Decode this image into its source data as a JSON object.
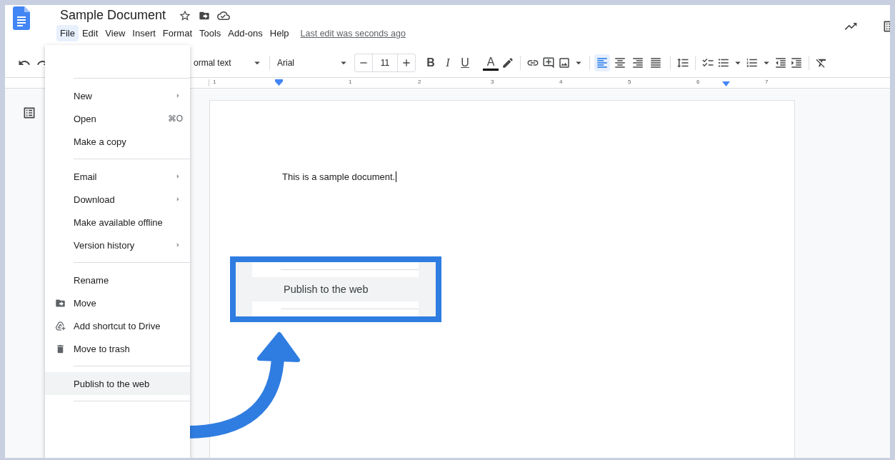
{
  "document": {
    "title": "Sample Document",
    "last_edit": "Last edit was seconds ago"
  },
  "menu_bar": [
    {
      "label": "File",
      "selected": true
    },
    {
      "label": "Edit",
      "selected": false
    },
    {
      "label": "View",
      "selected": false
    },
    {
      "label": "Insert",
      "selected": false
    },
    {
      "label": "Format",
      "selected": false
    },
    {
      "label": "Tools",
      "selected": false
    },
    {
      "label": "Add-ons",
      "selected": false
    },
    {
      "label": "Help",
      "selected": false
    }
  ],
  "toolbar": {
    "style_select": "ormal text",
    "font": "Arial",
    "font_size": "11",
    "format_buttons": [
      {
        "label": "B"
      },
      {
        "label": "I"
      },
      {
        "label": "U"
      },
      {
        "label": "A"
      }
    ],
    "align_buttons": [
      {
        "selected": true
      },
      {
        "selected": false
      },
      {
        "selected": false
      },
      {
        "selected": false
      }
    ]
  },
  "ruler": [
    "1",
    "1",
    "2",
    "3",
    "4",
    "5",
    "6",
    "7"
  ],
  "file_menu": [
    {
      "kind": "separator"
    },
    {
      "kind": "item",
      "label": "New",
      "has_submenu": true,
      "selected": false
    },
    {
      "kind": "item",
      "label": "Open",
      "shortcut": "⌘O",
      "has_submenu": false,
      "selected": false
    },
    {
      "kind": "item",
      "label": "Make a copy",
      "has_submenu": false,
      "selected": false
    },
    {
      "kind": "separator"
    },
    {
      "kind": "item",
      "label": "Email",
      "has_submenu": true,
      "selected": false
    },
    {
      "kind": "item",
      "label": "Download",
      "has_submenu": true,
      "selected": false
    },
    {
      "kind": "item",
      "label": "Make available offline",
      "has_submenu": false,
      "selected": false
    },
    {
      "kind": "item",
      "label": "Version history",
      "has_submenu": true,
      "selected": false
    },
    {
      "kind": "separator"
    },
    {
      "kind": "item",
      "label": "Rename",
      "has_submenu": false,
      "selected": false
    },
    {
      "kind": "item",
      "label": "Move",
      "has_submenu": false,
      "selected": false
    },
    {
      "kind": "item",
      "label": "Add shortcut to Drive",
      "has_submenu": false,
      "selected": false
    },
    {
      "kind": "item",
      "label": "Move to trash",
      "has_submenu": false,
      "selected": false
    },
    {
      "kind": "separator"
    },
    {
      "kind": "item",
      "label": "Publish to the web",
      "has_submenu": false,
      "selected": true
    },
    {
      "kind": "separator"
    }
  ],
  "page": {
    "text": "This is a sample document."
  },
  "callout": {
    "label": "Publish to the web"
  }
}
